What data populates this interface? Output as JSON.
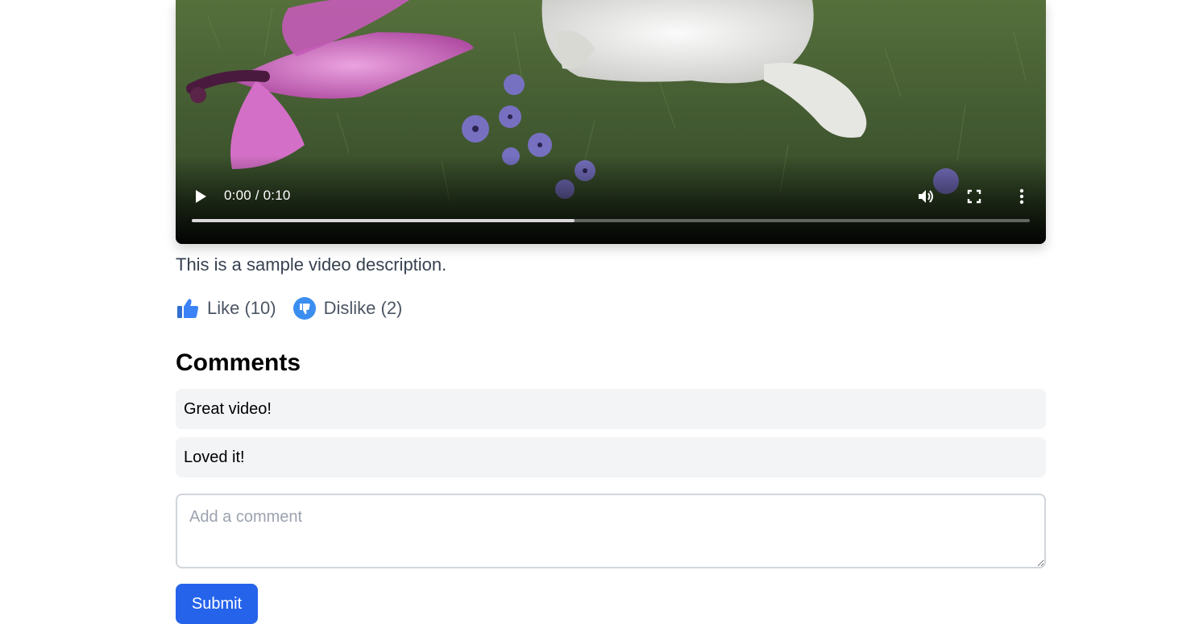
{
  "video": {
    "time_display": "0:00 / 0:10",
    "progress_fraction": 0.457
  },
  "description": "This is a sample video description.",
  "reactions": {
    "like_label": "Like (10)",
    "dislike_label": "Dislike (2)"
  },
  "comments": {
    "title": "Comments",
    "items": [
      "Great video!",
      "Loved it!"
    ],
    "input_placeholder": "Add a comment",
    "submit_label": "Submit"
  },
  "colors": {
    "primary": "#2563eb",
    "comment_bg": "#f3f4f6",
    "like_icon": "#3b82f6"
  },
  "icons": {
    "play": "play-icon",
    "volume": "volume-icon",
    "fullscreen": "fullscreen-icon",
    "more": "more-vertical-icon",
    "like": "thumbs-up-icon",
    "dislike": "thumbs-down-icon"
  }
}
